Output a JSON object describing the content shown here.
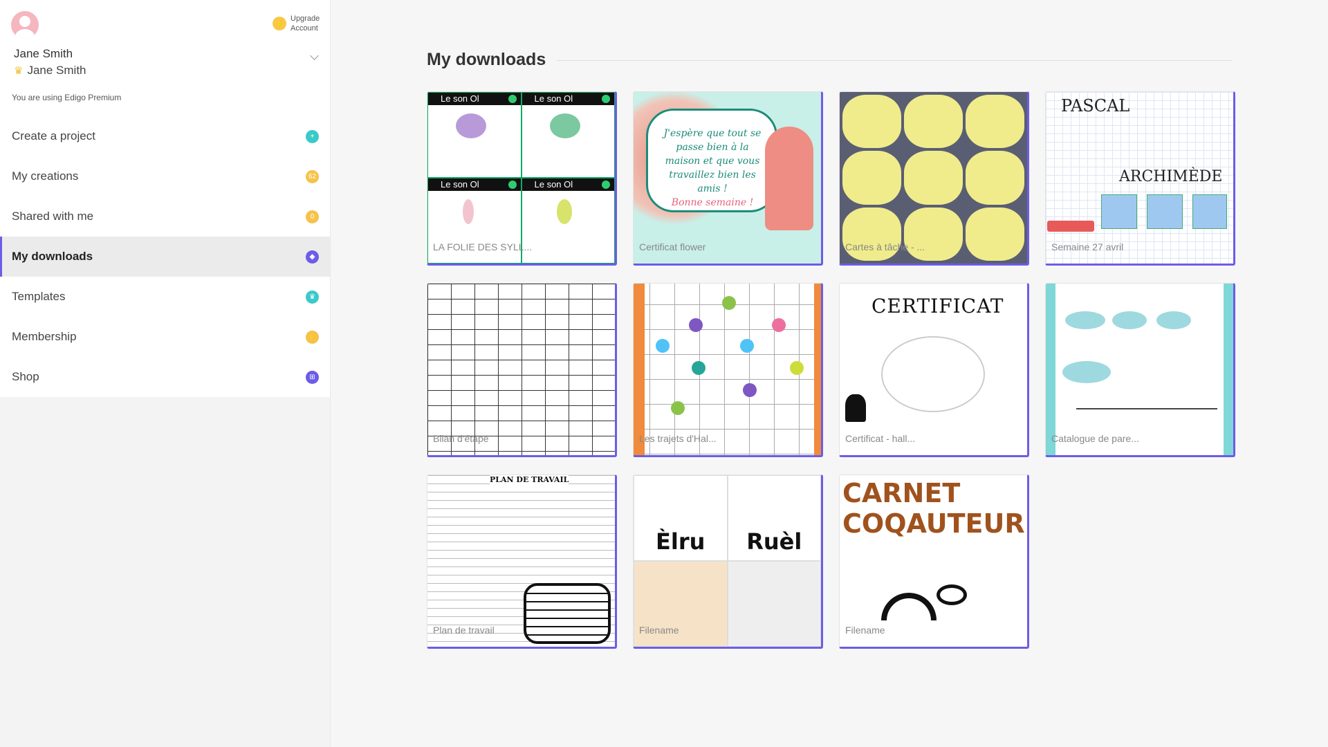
{
  "profile": {
    "upgrade_label_line1": "Upgrade",
    "upgrade_label_line2": "Account",
    "user_name": "Jane Smith",
    "account_name": "Jane Smith",
    "plan_text": "You are using Edigo Premium"
  },
  "nav": {
    "items": [
      {
        "label": "Create a project",
        "badge": "+",
        "color": "#3cc9c9"
      },
      {
        "label": "My creations",
        "badge": "62",
        "color": "#f5c34a"
      },
      {
        "label": "Shared with me",
        "badge": "0",
        "color": "#f5c34a"
      },
      {
        "label": "My downloads",
        "badge": "",
        "color": "#6c5ce7",
        "active": true
      },
      {
        "label": "Templates",
        "badge": "",
        "color": "#3cc9c9"
      },
      {
        "label": "Membership",
        "badge": "",
        "color": "#f5c34a"
      },
      {
        "label": "Shop",
        "badge": "",
        "color": "#6c5ce7"
      }
    ]
  },
  "main": {
    "title": "My downloads",
    "cards": [
      {
        "name": "LA FOLIE DES SYLL...",
        "thumb_text": "Le son Ol"
      },
      {
        "name": "Certificat flower",
        "thumb_text": "J'espère que tout se passe bien à la maison et que vous travaillez bien les amis !",
        "thumb_text2": "Bonne semaine !"
      },
      {
        "name": "Cartes à tâche - ..."
      },
      {
        "name": "Semaine 27 avril",
        "thumb_text": "PASCAL",
        "thumb_text2": "ARCHIMÈDE"
      },
      {
        "name": "Bilan d'étape"
      },
      {
        "name": "Les trajets d'Hal..."
      },
      {
        "name": "Certificat - hall...",
        "thumb_text": "CERTIFICAT"
      },
      {
        "name": "Catalogue de pare..."
      },
      {
        "name": "Plan de travail",
        "thumb_text": "PLAN DE TRAVAIL"
      },
      {
        "name": "Filename",
        "thumb_text": "Èlru",
        "thumb_text2": "Ruèl"
      },
      {
        "name": "Filename",
        "thumb_text": "CARNET COQAUTEUR"
      }
    ]
  }
}
